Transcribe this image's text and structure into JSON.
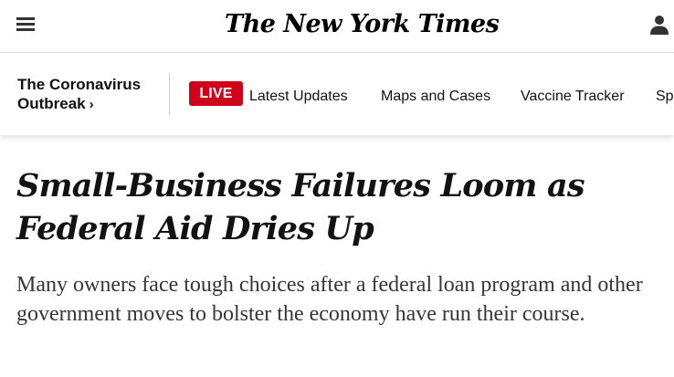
{
  "masthead": {
    "logo_text": "The New York Times",
    "menu_icon": "hamburger-menu-icon",
    "account_icon": "user-account-icon"
  },
  "covid_nav": {
    "title_line1": "The Coronavirus",
    "title_line2": "Outbreak",
    "chevron": "›",
    "live_label": "LIVE",
    "live_color": "#d0021b",
    "links": [
      {
        "label": "Latest Updates"
      },
      {
        "label": "Maps and Cases"
      },
      {
        "label": "Vaccine Tracker"
      },
      {
        "label": "Sp"
      }
    ]
  },
  "article": {
    "headline": "Small-Business Failures Loom as Federal Aid Dries Up",
    "summary": "Many owners face tough choices after a federal loan program and other government moves to bolster the economy have run their course."
  }
}
